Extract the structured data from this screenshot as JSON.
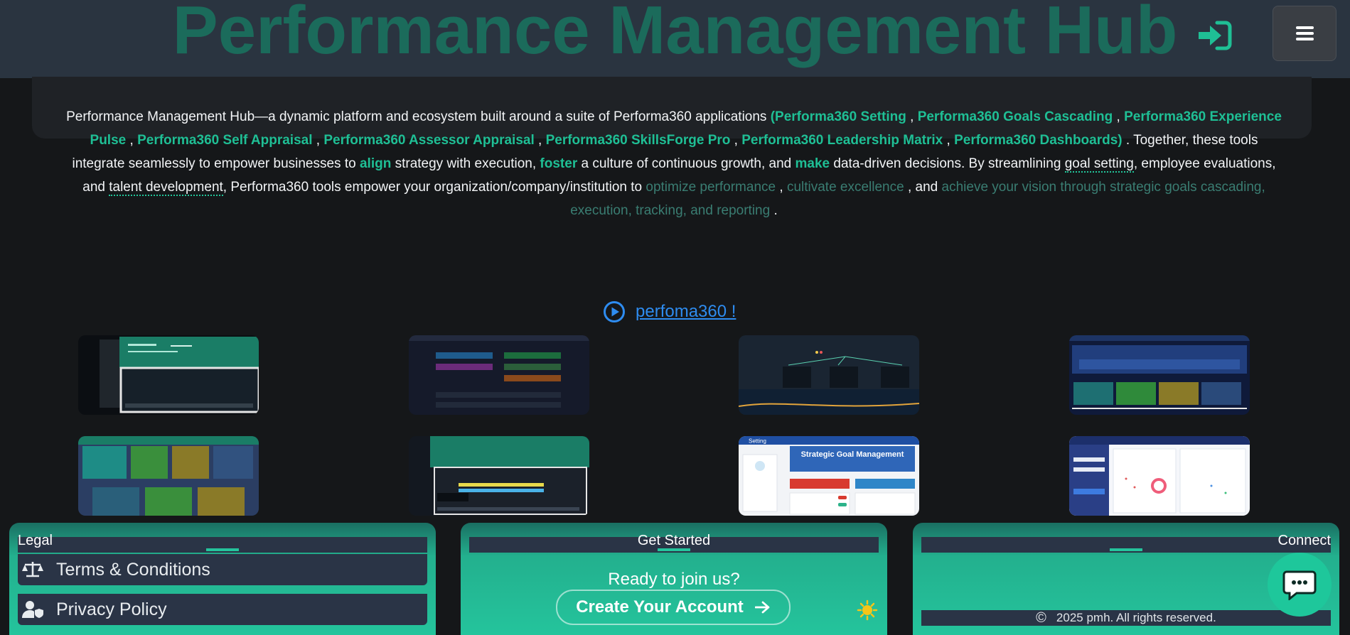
{
  "header": {
    "brand": "Performance Management Hub",
    "login_icon": "sign-in-icon",
    "menu_icon": "hamburger-menu-icon"
  },
  "intro": {
    "p1": "Performance Management Hub—a dynamic platform and ecosystem built around a suite of Performa360 applications ",
    "apps": [
      "(Performa360 Setting",
      "Performa360 Goals Cascading",
      "Performa360 Experience Pulse",
      "Performa360 Self Appraisal",
      "Performa360 Assessor Appraisal",
      "Performa360 SkillsForge Pro",
      "Performa360 Leadership Matrix",
      "Performa360 Dashboards)"
    ],
    "sep": " , ",
    "p2": " . Together, these tools integrate seamlessly to empower businesses to ",
    "align": "align",
    "p3": " strategy with execution, ",
    "foster": "foster",
    "p4": " a culture of continuous growth, and ",
    "make": "make",
    "p5": " data-driven decisions. By streamlining ",
    "goal_setting": "goal setting",
    "p6": ", employee evaluations, and ",
    "talent_dev": "talent development",
    "p7": ", Performa360 tools empower your organization/company/institution to ",
    "optimize": "optimize performance",
    "p8": " , ",
    "cultivate": "cultivate excellence",
    "p9": " , and ",
    "achieve": "achieve your vision through strategic goals cascading, execution, tracking, and reporting",
    "p10": " ."
  },
  "video": {
    "label": "perfoma360 !",
    "icon": "play-circle-icon"
  },
  "thumbnails": {
    "t7_title": "Strategic Goal Management",
    "t7_tab": "Setting"
  },
  "footer": {
    "legal_title": "Legal",
    "terms": "Terms & Conditions",
    "privacy": "Privacy Policy",
    "get_started_title": "Get Started",
    "ready": "Ready to join us?",
    "create_account": "Create Your Account",
    "connect_title": "Connect",
    "copyright": "2025 pmh. All rights reserved.",
    "copyright_symbol": "©"
  },
  "colors": {
    "accent": "#1fbf95",
    "header_bg": "#2a3440",
    "brand_text": "#1b6b5b",
    "link": "#2e8cf0"
  }
}
